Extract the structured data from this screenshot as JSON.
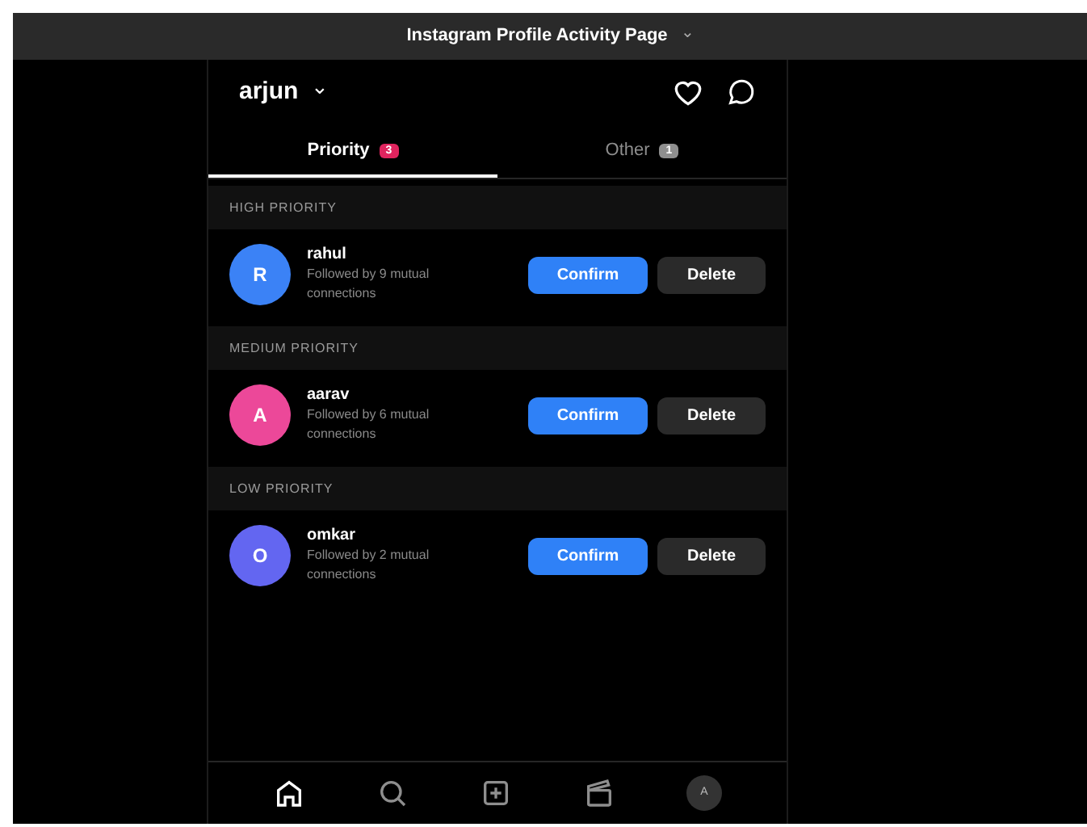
{
  "window": {
    "title": "Instagram Profile Activity Page",
    "title_caret": "⌄"
  },
  "header": {
    "username": "arjun",
    "caret": "⌄"
  },
  "tabs": [
    {
      "label": "Priority",
      "count": "3",
      "selected": true,
      "color": "#e0245e"
    },
    {
      "label": "Other",
      "count": "1",
      "selected": false,
      "color": "#8e8e8e"
    }
  ],
  "sections": [
    {
      "title": "HIGH PRIORITY",
      "requests": [
        {
          "initial": "R",
          "name": "rahul",
          "subtitle": "Followed by 9 mutual connections",
          "color": "#3b82f6",
          "confirm": "Confirm",
          "delete": "Delete"
        }
      ]
    },
    {
      "title": "MEDIUM PRIORITY",
      "requests": [
        {
          "initial": "A",
          "name": "aarav",
          "subtitle": "Followed by 6 mutual connections",
          "color": "#ec4899",
          "confirm": "Confirm",
          "delete": "Delete"
        }
      ]
    },
    {
      "title": "LOW PRIORITY",
      "requests": [
        {
          "initial": "O",
          "name": "omkar",
          "subtitle": "Followed by 2 mutual connections",
          "color": "#6366f1",
          "confirm": "Confirm",
          "delete": "Delete"
        }
      ]
    }
  ],
  "bottom_nav": [
    {
      "kind": "home",
      "selected": true
    },
    {
      "kind": "search",
      "selected": false
    },
    {
      "kind": "create",
      "selected": false
    },
    {
      "kind": "reels",
      "selected": false
    },
    {
      "kind": "profile",
      "label": "A",
      "selected": false
    }
  ]
}
